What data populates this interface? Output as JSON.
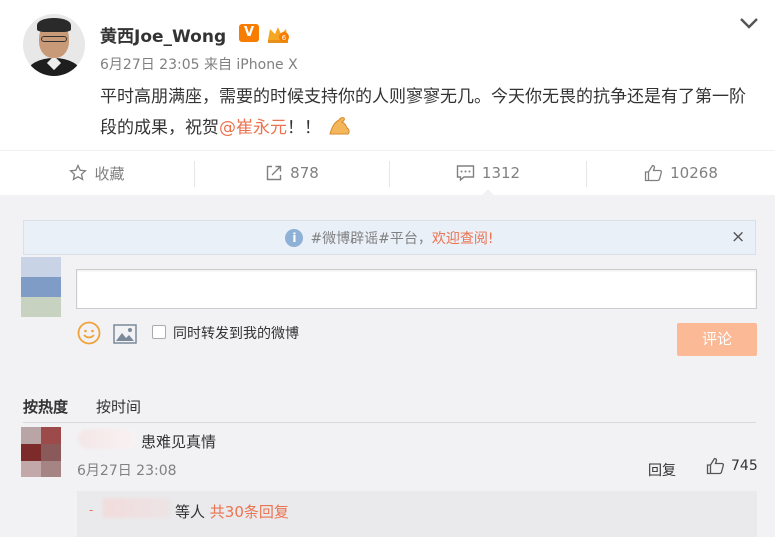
{
  "post": {
    "username": "黄西Joe_Wong",
    "verified_badge": "V",
    "meta": "6月27日 23:05 来自 iPhone X",
    "content_before_mention": "平时高朋满座，需要的时候支持你的人则寥寥无几。今天你无畏的抗争还是有了第一阶段的成果，祝贺",
    "mention": "@崔永元",
    "content_after_mention": "！！",
    "emoji": "flexed-biceps-emoji"
  },
  "actions": {
    "favorite_label": "收藏",
    "repost_count": "878",
    "comment_count": "1312",
    "like_count": "10268"
  },
  "notice": {
    "text": "#微博辟谣#平台，",
    "link": "欢迎查阅!",
    "close": "×"
  },
  "composer": {
    "input_value": "",
    "also_repost_label": "同时转发到我的微博",
    "submit_label": "评论"
  },
  "sort": {
    "by_hot": "按热度",
    "by_time": "按时间"
  },
  "comments": [
    {
      "text": "患难见真情",
      "time": "6月27日 23:08",
      "reply_label": "回复",
      "likes": "745",
      "replies_prefix": "等人",
      "replies_link": "共30条回复"
    }
  ],
  "colors": {
    "accent": "#eb7350",
    "badge": "#f77c00",
    "submit_disabled": "#fbb996",
    "page_bg": "#f2f2f5"
  }
}
